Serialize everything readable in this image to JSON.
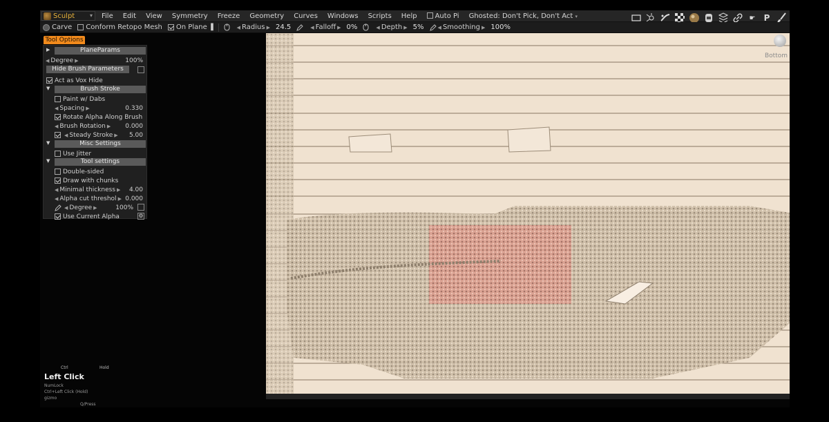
{
  "menubar": {
    "mode": "Sculpt",
    "items": [
      "File",
      "Edit",
      "View",
      "Symmetry",
      "Freeze",
      "Geometry",
      "Curves",
      "Windows",
      "Scripts",
      "Help"
    ],
    "auto_pick": "Auto Pi",
    "ghosted": "Ghosted: Don't Pick, Don't Act"
  },
  "toolbar": {
    "carve": "Carve",
    "conform_retopo": "Conform Retopo Mesh",
    "on_plane": "On Plane",
    "radius_label": "Radius",
    "radius_value": "24.5",
    "falloff_label": "Falloff",
    "falloff_value": "0%",
    "depth_label": "Depth",
    "depth_value": "5%",
    "smoothing_label": "Smoothing",
    "smoothing_value": "100%"
  },
  "panel": {
    "tab": "Tool Options",
    "plane_params": "PlaneParams",
    "degree_label": "Degree",
    "degree_value": "100%",
    "hide_brush_params": "Hide Brush Parameters",
    "act_as_vox_hide": "Act as Vox Hide",
    "brush_stroke": "Brush Stroke",
    "paint_w_dabs": "Paint w/ Dabs",
    "spacing_label": "Spacing",
    "spacing_value": "0.330",
    "rotate_alpha": "Rotate Alpha Along Brush",
    "brush_rotation_label": "Brush Rotation",
    "brush_rotation_value": "0.000",
    "steady_stroke_label": "Steady Stroke",
    "steady_stroke_value": "5.00",
    "misc_settings": "Misc Settings",
    "use_jitter": "Use Jitter",
    "tool_settings": "Tool settings",
    "double_sided": "Double-sided",
    "draw_with_chunks": "Draw with chunks",
    "minimal_thickness_label": "Minimal thickness",
    "minimal_thickness_value": "4.00",
    "alpha_cut_label": "Alpha cut threshol",
    "alpha_cut_value": "0.000",
    "degree2_label": "Degree",
    "degree2_value": "100%",
    "use_current_alpha": "Use Current Alpha"
  },
  "viewport": {
    "view_label": "Bottom"
  },
  "hints": {
    "ctrl": "Ctrl",
    "hold": "Hold",
    "left_click": "Left Click",
    "numlock": "NumLock",
    "ctrl_left_click": "Ctrl+Left Click (Hold)",
    "gizmo": "gizmo",
    "q_press": "Q/Press"
  }
}
